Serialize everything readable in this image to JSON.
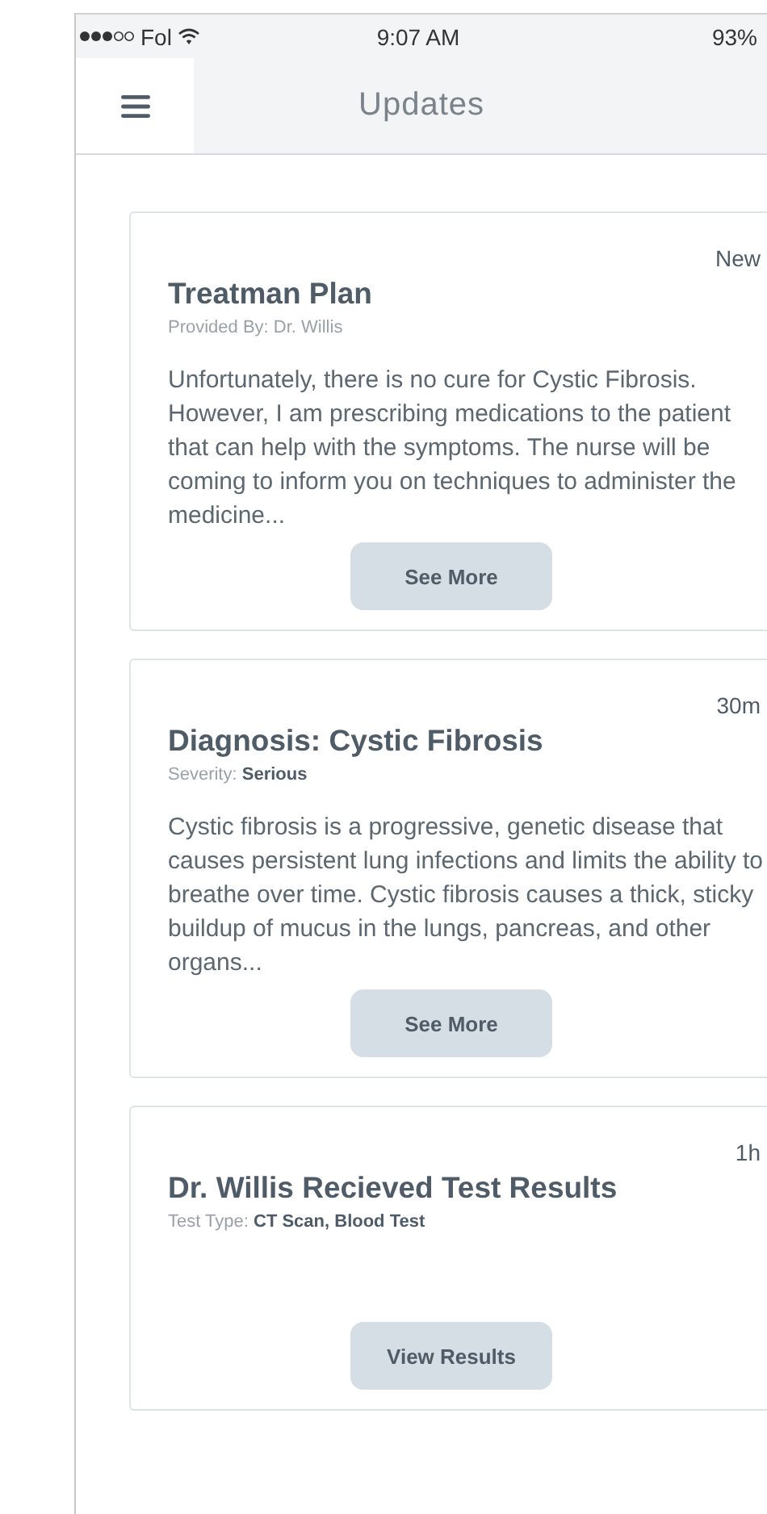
{
  "status_bar": {
    "carrier": "Fol",
    "time": "9:07 AM",
    "battery": "93%"
  },
  "nav": {
    "title": "Updates"
  },
  "updates": [
    {
      "time": "New",
      "title": "Treatman Plan",
      "subtitle": "Provided By: Dr. Willis",
      "body": "Unfortunately, there is no cure for Cystic Fibrosis. However, I am prescribing medications to the patient that can help with the symptoms. The nurse will be coming to inform you on techniques to administer the medicine...",
      "button": "See More"
    },
    {
      "time": "30m",
      "title": "Diagnosis: Cystic Fibrosis",
      "subtitle": "Severity: **Serious**",
      "body": "Cystic fibrosis is a progressive, genetic disease that causes persistent lung infections and limits the ability to breathe over time. Cystic fibrosis causes a thick, sticky buildup of mucus in the lungs, pancreas, and other organs...",
      "button": "See More"
    },
    {
      "time": "1h",
      "title": "Dr. Willis Recieved Test Results",
      "subtitle": "Test Type: **CT Scan, Blood Test**",
      "button": "View Results"
    }
  ]
}
